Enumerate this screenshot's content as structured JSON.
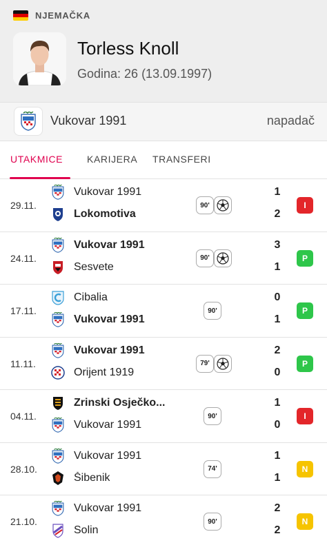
{
  "header": {
    "country": "NJEMAČKA",
    "player_name": "Torless Knoll",
    "age_line": "Godina: 26 (13.09.1997)"
  },
  "team_row": {
    "team": "Vukovar 1991",
    "position": "napadač"
  },
  "tabs": [
    {
      "label": "UTAKMICE",
      "active": true
    },
    {
      "label": "KARIJERA",
      "active": false
    },
    {
      "label": "TRANSFERI",
      "active": false
    }
  ],
  "colors": {
    "accent": "#e0004e",
    "loss": "#e3262a",
    "win": "#2ec64a",
    "draw": "#f6c400"
  },
  "matches": [
    {
      "date": "29.11.",
      "home": "Vukovar 1991",
      "away": "Lokomotiva",
      "home_score": "1",
      "away_score": "2",
      "bold": "away",
      "minutes": "90'",
      "goal": true,
      "result": "I",
      "result_type": "loss",
      "home_crest": "vukovar",
      "away_crest": "lokomotiva"
    },
    {
      "date": "24.11.",
      "home": "Vukovar 1991",
      "away": "Sesvete",
      "home_score": "3",
      "away_score": "1",
      "bold": "home",
      "minutes": "90'",
      "goal": true,
      "result": "P",
      "result_type": "win",
      "home_crest": "vukovar",
      "away_crest": "sesvete"
    },
    {
      "date": "17.11.",
      "home": "Cibalia",
      "away": "Vukovar 1991",
      "home_score": "0",
      "away_score": "1",
      "bold": "away",
      "minutes": "90'",
      "goal": false,
      "result": "P",
      "result_type": "win",
      "home_crest": "cibalia",
      "away_crest": "vukovar"
    },
    {
      "date": "11.11.",
      "home": "Vukovar 1991",
      "away": "Orijent 1919",
      "home_score": "2",
      "away_score": "0",
      "bold": "home",
      "minutes": "79'",
      "goal": true,
      "result": "P",
      "result_type": "win",
      "home_crest": "vukovar",
      "away_crest": "orijent"
    },
    {
      "date": "04.11.",
      "home": "Zrinski Osječko...",
      "away": "Vukovar 1991",
      "home_score": "1",
      "away_score": "0",
      "bold": "home",
      "minutes": "90'",
      "goal": false,
      "result": "I",
      "result_type": "loss",
      "home_crest": "zrinski",
      "away_crest": "vukovar"
    },
    {
      "date": "28.10.",
      "home": "Vukovar 1991",
      "away": "Šibenik",
      "home_score": "1",
      "away_score": "1",
      "bold": "none",
      "minutes": "74'",
      "goal": false,
      "result": "N",
      "result_type": "draw",
      "home_crest": "vukovar",
      "away_crest": "sibenik"
    },
    {
      "date": "21.10.",
      "home": "Vukovar 1991",
      "away": "Solin",
      "home_score": "2",
      "away_score": "2",
      "bold": "none",
      "minutes": "90'",
      "goal": false,
      "result": "N",
      "result_type": "draw",
      "home_crest": "vukovar",
      "away_crest": "solin"
    }
  ]
}
